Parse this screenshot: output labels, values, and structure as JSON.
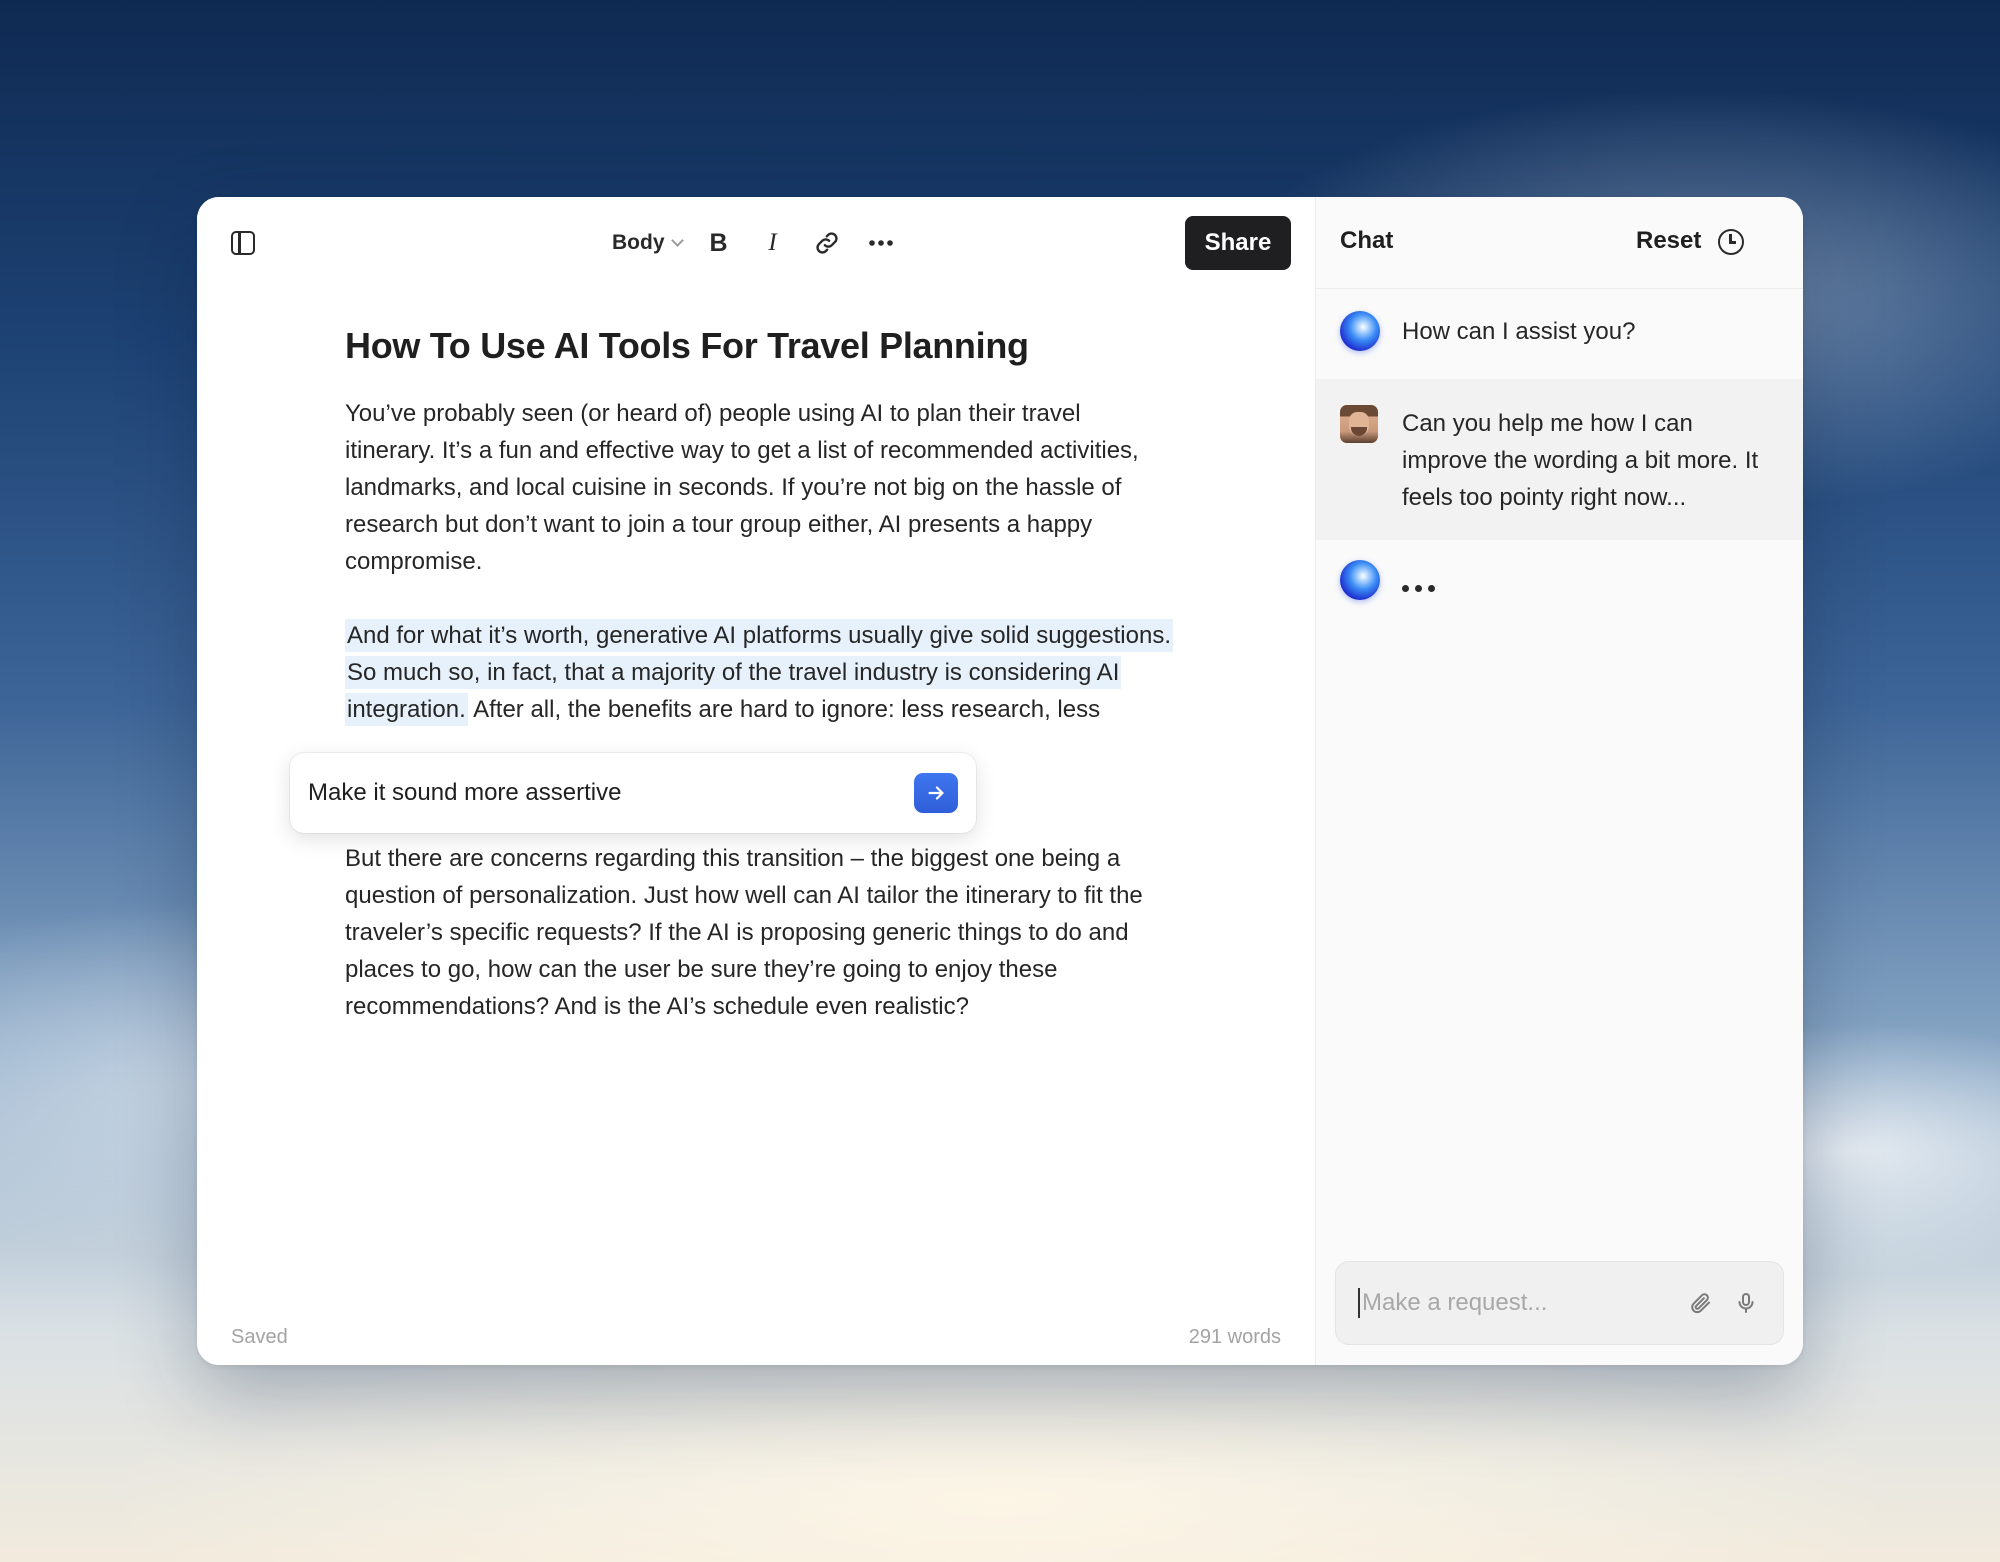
{
  "toolbar": {
    "style_label": "Body",
    "share_label": "Share"
  },
  "document": {
    "title": "How To Use AI Tools For Travel Planning",
    "paragraph_1": "You’ve probably seen (or heard of) people using AI to plan their travel itinerary. It’s a fun and effective way to get a list of recommended activities, landmarks, and local cuisine in seconds. If you’re not big on the hassle of research but don’t want to join a tour group either, AI presents a happy compromise.",
    "paragraph_2_selected": "And for what it’s worth, generative AI platforms usually give solid suggestions. So much so, in fact, that a majority of the travel industry is considering AI integration.",
    "paragraph_2_rest": " After all, the benefits are hard to ignore: less research, less information curation, quicker turnaround time, more",
    "paragraph_3": "But there are concerns regarding this transition – the biggest one being a question of personalization. Just how well can AI tailor the itinerary to fit the traveler’s specific requests? If the AI is proposing generic things to do and places to go, how can the user be sure they’re going to enjoy these recommendations? And is the AI’s schedule even realistic?"
  },
  "inline_prompt": {
    "value": "Make it sound more assertive"
  },
  "status": {
    "saved": "Saved",
    "word_count": "291 words"
  },
  "chat": {
    "title": "Chat",
    "reset_label": "Reset",
    "messages": [
      {
        "role": "assistant",
        "text": "How can I assist you?"
      },
      {
        "role": "user",
        "text": "Can you help me how I can improve the wording a bit more. It feels too pointy right now..."
      },
      {
        "role": "assistant",
        "text": ""
      }
    ],
    "input_placeholder": "Make a request..."
  },
  "colors": {
    "accent": "#3366e0",
    "selection": "#e6f1fb",
    "share_bg": "#1f1f22"
  },
  "icons": [
    "sidebar-toggle-icon",
    "bold-icon",
    "italic-icon",
    "link-icon",
    "more-icon",
    "history-icon",
    "send-arrow-icon",
    "paperclip-icon",
    "microphone-icon",
    "ai-orb-icon"
  ]
}
